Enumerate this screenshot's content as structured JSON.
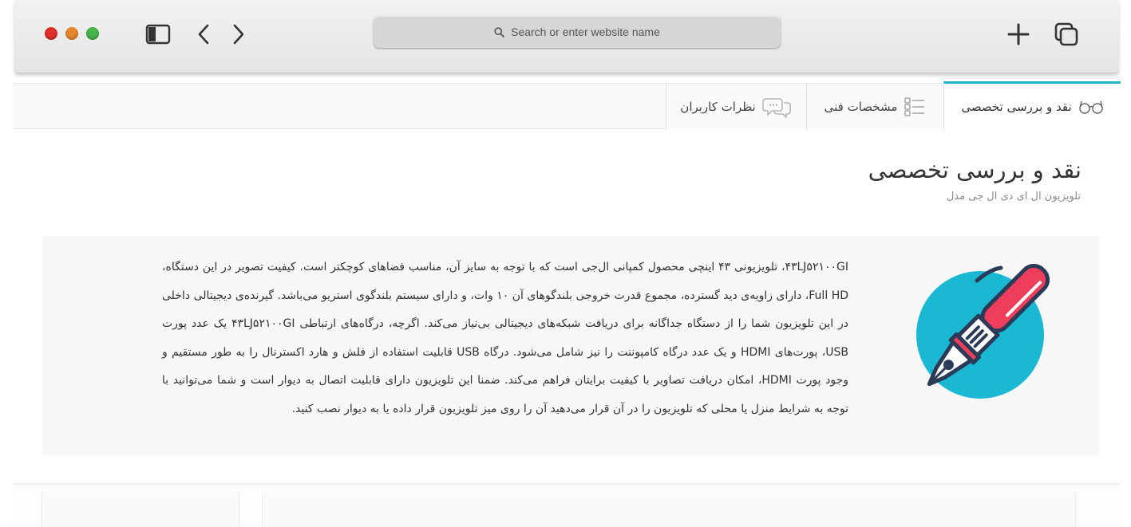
{
  "browser": {
    "address_placeholder": "Search or enter website name"
  },
  "tabs": [
    {
      "label": "نقد و بررسی تخصصی",
      "icon": "glasses-icon",
      "active": true
    },
    {
      "label": "مشخصات فنی",
      "icon": "checklist-icon",
      "active": false
    },
    {
      "label": "نظرات کاربران",
      "icon": "chat-bubbles-icon",
      "active": false
    }
  ],
  "main": {
    "title": "نقد و بررسی تخصصی",
    "subtitle": "تلویزیون ال ای دی ال جی مدل",
    "body": "۴۳LJ۵۲۱۰۰GI، تلویزیونی ۴۳ اینچی محصول کمپانی ال‌جی است که با توجه به سایز آن، مناسب فضاهای کوچکتر است. کیفیت تصویر در این دستگاه، Full HD، دارای زاویه‌ی دید گسترده، مجموع قدرت خروجی بلندگوهای آن ۱۰ وات، و دارای سیستم بلندگوی استریو می‌باشد. گیرنده‌ی دیجیتالی داخلی در این تلویزیون شما را از دستگاه جداگانه برای دریافت شبکه‌های دیجیتالی بی‌نیاز می‌کند. اگرچه، درگاه‌های ارتباطی ۴۳LJ۵۲۱۰۰GI یک عدد پورت USB، پورت‌های HDMI و یک عدد درگاه کامپوننت را نیز شامل می‌شود. درگاه USB قابلیت استفاده از فلش و هارد اکسترنال را به طور مستقیم و وجود پورت HDMI، امکان دریافت تصاویر با کیفیت برایتان فراهم می‌کند. ضمنا این تلویزیون دارای قابلیت اتصال به دیوار است و شما می‌توانید با توجه به شرایط منزل یا محلی که تلویزیون را در آن قرار می‌دهید آن را روی میز تلویزیون قرار داده یا به دیوار نصب کنید.",
    "illustration": "pen-icon"
  },
  "colors": {
    "accent": "#1fb5c7",
    "illustration_circle": "#1ab8d2",
    "pen_body": "#ef3e5c",
    "pen_outline": "#2a3a57"
  }
}
